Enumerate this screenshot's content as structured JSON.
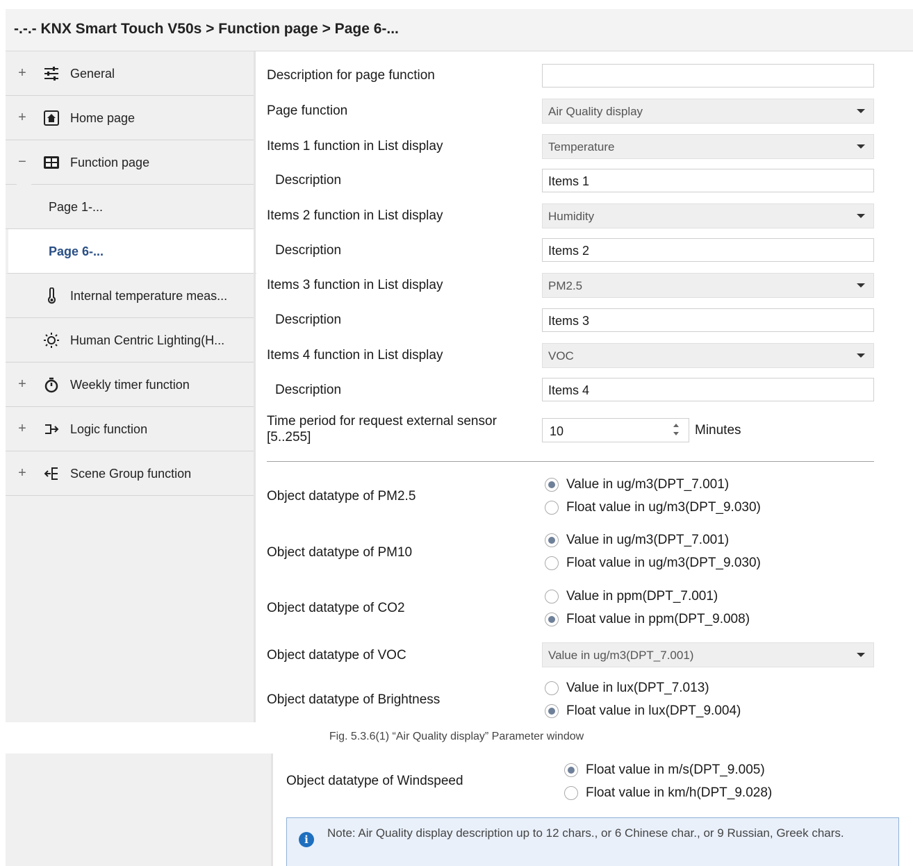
{
  "title": "-.-.- KNX Smart Touch V50s > Function page > Page 6-...",
  "sidebar": [
    {
      "sign": "+",
      "icon": "sliders-icon",
      "label": "General"
    },
    {
      "sign": "+",
      "icon": "home-icon",
      "label": "Home page"
    },
    {
      "sign": "−",
      "icon": "grid-icon",
      "label": "Function page"
    },
    {
      "sign": "",
      "icon": "",
      "label": "Page 1-..."
    },
    {
      "sign": "",
      "icon": "",
      "label": "Page 6-..."
    },
    {
      "sign": "",
      "icon": "thermometer-icon",
      "label": "Internal temperature meas..."
    },
    {
      "sign": "",
      "icon": "sun-icon",
      "label": "Human Centric Lighting(H..."
    },
    {
      "sign": "+",
      "icon": "stopwatch-icon",
      "label": "Weekly timer function"
    },
    {
      "sign": "+",
      "icon": "logic-icon",
      "label": "Logic function"
    },
    {
      "sign": "+",
      "icon": "scene-icon",
      "label": "Scene Group function"
    }
  ],
  "params": {
    "desc_page_label": "Description for page function",
    "desc_page_value": "",
    "page_function_label": "Page function",
    "page_function_value": "Air Quality display",
    "item1_label": "Items 1 function in List display",
    "item1_value": "Temperature",
    "item2_label": "Items 2 function in List display",
    "item2_value": "Humidity",
    "item3_label": "Items 3 function in List display",
    "item3_value": "PM2.5",
    "item4_label": "Items 4 function in List display",
    "item4_value": "VOC",
    "description_label": "Description",
    "desc1_value": "Items 1",
    "desc2_value": "Items 2",
    "desc3_value": "Items 3",
    "desc4_value": "Items 4",
    "time_label_1": "Time period for request external sensor",
    "time_label_2": "[5..255]",
    "time_value": "10",
    "time_unit": "Minutes",
    "pm25_label": "Object datatype of PM2.5",
    "pm25_opt1": "Value in ug/m3(DPT_7.001)",
    "pm25_opt2": "Float value in ug/m3(DPT_9.030)",
    "pm10_label": "Object datatype of PM10",
    "pm10_opt1": "Value in ug/m3(DPT_7.001)",
    "pm10_opt2": "Float value in ug/m3(DPT_9.030)",
    "co2_label": "Object datatype of CO2",
    "co2_opt1": "Value in ppm(DPT_7.001)",
    "co2_opt2": "Float value in ppm(DPT_9.008)",
    "voc_label": "Object datatype of VOC",
    "voc_value": "Value in ug/m3(DPT_7.001)",
    "bright_label": "Object datatype of Brightness",
    "bright_opt1": "Value in lux(DPT_7.013)",
    "bright_opt2": "Float value in lux(DPT_9.004)"
  },
  "caption": "Fig. 5.3.6(1) “Air Quality display” Parameter window",
  "second": {
    "wind_label": "Object datatype of Windspeed",
    "wind_opt1": "Float value in m/s(DPT_9.005)",
    "wind_opt2": "Float value in km/h(DPT_9.028)",
    "note_icon": "info-icon",
    "note_text": "Note: Air Quality display description up to 12 chars., or 6 Chinese char., or 9 Russian, Greek chars."
  },
  "colors": {
    "accent": "#2a4f86",
    "radio_dot": "#6f8099",
    "note_bg": "#e9f0fa",
    "note_border": "#8fb0d8"
  }
}
